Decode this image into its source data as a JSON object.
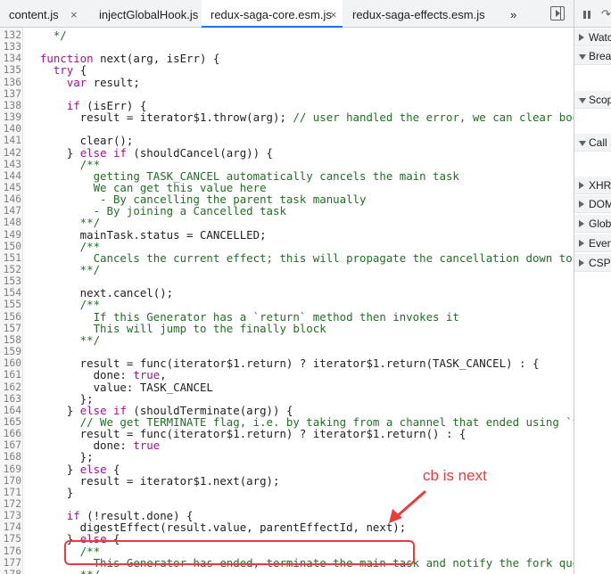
{
  "tabs": [
    {
      "label": "content.js",
      "closable": true,
      "active": false
    },
    {
      "label": "injectGlobalHook.js",
      "closable": false,
      "active": false
    },
    {
      "label": "redux-saga-core.esm.js",
      "closable": true,
      "active": true
    },
    {
      "label": "redux-saga-effects.esm.js",
      "closable": false,
      "active": false
    },
    {
      "label": "»",
      "closable": false,
      "active": false
    }
  ],
  "close_glyph": "×",
  "sidebar": {
    "step_glyph": "↷",
    "sections": [
      {
        "label": "Watch",
        "state": "closed"
      },
      {
        "label": "Breakpoints",
        "state": "open"
      },
      {
        "label": "Scope",
        "state": "open"
      },
      {
        "label": "Call Stack",
        "state": "open"
      },
      {
        "label": "XHR/fetch Breakpoints",
        "state": "closed"
      },
      {
        "label": "DOM Breakpoints",
        "state": "closed"
      },
      {
        "label": "Global Listeners",
        "state": "closed"
      },
      {
        "label": "Event Listener Breakpoints",
        "state": "closed"
      },
      {
        "label": "CSP Violation Breakpoints",
        "state": "closed"
      }
    ]
  },
  "annotation": {
    "text": "cb is next",
    "color": "#ee3a3a"
  },
  "code_lines": [
    {
      "n": "132",
      "t": [
        [
          "cm",
          "    */"
        ]
      ]
    },
    {
      "n": "133",
      "t": [
        [
          "pl",
          ""
        ]
      ]
    },
    {
      "n": "134",
      "t": [
        [
          "pl",
          "  "
        ],
        [
          "kw",
          "function"
        ],
        [
          "pl",
          " next(arg, isErr) {"
        ]
      ]
    },
    {
      "n": "135",
      "t": [
        [
          "pl",
          "    "
        ],
        [
          "kw",
          "try"
        ],
        [
          "pl",
          " {"
        ]
      ]
    },
    {
      "n": "136",
      "t": [
        [
          "pl",
          "      "
        ],
        [
          "kw",
          "var"
        ],
        [
          "pl",
          " result;"
        ]
      ]
    },
    {
      "n": "137",
      "t": [
        [
          "pl",
          ""
        ]
      ]
    },
    {
      "n": "138",
      "t": [
        [
          "pl",
          "      "
        ],
        [
          "kw",
          "if"
        ],
        [
          "pl",
          " (isErr) {"
        ]
      ]
    },
    {
      "n": "139",
      "t": [
        [
          "pl",
          "        result = iterator$1.throw(arg); "
        ],
        [
          "cm",
          "// user handled the error, we can clear bookke"
        ]
      ]
    },
    {
      "n": "140",
      "t": [
        [
          "pl",
          ""
        ]
      ]
    },
    {
      "n": "141",
      "t": [
        [
          "pl",
          "        clear();"
        ]
      ]
    },
    {
      "n": "142",
      "t": [
        [
          "pl",
          "      } "
        ],
        [
          "kw",
          "else if"
        ],
        [
          "pl",
          " (shouldCancel(arg)) {"
        ]
      ]
    },
    {
      "n": "143",
      "t": [
        [
          "cm",
          "        /**"
        ]
      ]
    },
    {
      "n": "144",
      "t": [
        [
          "cm",
          "          getting TASK_CANCEL automatically cancels the main task"
        ]
      ]
    },
    {
      "n": "145",
      "t": [
        [
          "cm",
          "          We can get this value here"
        ]
      ]
    },
    {
      "n": "146",
      "t": [
        [
          "cm",
          "           - By cancelling the parent task manually"
        ]
      ]
    },
    {
      "n": "147",
      "t": [
        [
          "cm",
          "          - By joining a Cancelled task"
        ]
      ]
    },
    {
      "n": "148",
      "t": [
        [
          "cm",
          "        **/"
        ]
      ]
    },
    {
      "n": "149",
      "t": [
        [
          "pl",
          "        mainTask.status = CANCELLED;"
        ]
      ]
    },
    {
      "n": "150",
      "t": [
        [
          "cm",
          "        /**"
        ]
      ]
    },
    {
      "n": "151",
      "t": [
        [
          "cm",
          "          Cancels the current effect; this will propagate the cancellation down to an"
        ]
      ]
    },
    {
      "n": "152",
      "t": [
        [
          "cm",
          "        **/"
        ]
      ]
    },
    {
      "n": "153",
      "t": [
        [
          "pl",
          ""
        ]
      ]
    },
    {
      "n": "154",
      "t": [
        [
          "pl",
          "        next.cancel();"
        ]
      ]
    },
    {
      "n": "155",
      "t": [
        [
          "cm",
          "        /**"
        ]
      ]
    },
    {
      "n": "156",
      "t": [
        [
          "cm",
          "          If this Generator has a `return` method then invokes it"
        ]
      ]
    },
    {
      "n": "157",
      "t": [
        [
          "cm",
          "          This will jump to the finally block"
        ]
      ]
    },
    {
      "n": "158",
      "t": [
        [
          "cm",
          "        **/"
        ]
      ]
    },
    {
      "n": "159",
      "t": [
        [
          "pl",
          ""
        ]
      ]
    },
    {
      "n": "160",
      "t": [
        [
          "pl",
          "        result = func(iterator$1.return) ? iterator$1.return(TASK_CANCEL) : {"
        ]
      ]
    },
    {
      "n": "161",
      "t": [
        [
          "pl",
          "          done: "
        ],
        [
          "kw",
          "true"
        ],
        [
          "pl",
          ","
        ]
      ]
    },
    {
      "n": "162",
      "t": [
        [
          "pl",
          "          value: TASK_CANCEL"
        ]
      ]
    },
    {
      "n": "163",
      "t": [
        [
          "pl",
          "        };"
        ]
      ]
    },
    {
      "n": "164",
      "t": [
        [
          "pl",
          "      } "
        ],
        [
          "kw",
          "else if"
        ],
        [
          "pl",
          " (shouldTerminate(arg)) {"
        ]
      ]
    },
    {
      "n": "165",
      "t": [
        [
          "cm",
          "        // We get TERMINATE flag, i.e. by taking from a channel that ended using `tak"
        ]
      ]
    },
    {
      "n": "166",
      "t": [
        [
          "pl",
          "        result = func(iterator$1.return) ? iterator$1.return() : {"
        ]
      ]
    },
    {
      "n": "167",
      "t": [
        [
          "pl",
          "          done: "
        ],
        [
          "kw",
          "true"
        ]
      ]
    },
    {
      "n": "168",
      "t": [
        [
          "pl",
          "        };"
        ]
      ]
    },
    {
      "n": "169",
      "t": [
        [
          "pl",
          "      } "
        ],
        [
          "kw",
          "else"
        ],
        [
          "pl",
          " {"
        ]
      ]
    },
    {
      "n": "170",
      "t": [
        [
          "pl",
          "        result = iterator$1.next(arg);"
        ]
      ]
    },
    {
      "n": "171",
      "t": [
        [
          "pl",
          "      }"
        ]
      ]
    },
    {
      "n": "172",
      "t": [
        [
          "pl",
          ""
        ]
      ]
    },
    {
      "n": "173",
      "t": [
        [
          "pl",
          "      "
        ],
        [
          "kw",
          "if"
        ],
        [
          "pl",
          " (!result.done) {"
        ]
      ]
    },
    {
      "n": "174",
      "t": [
        [
          "pl",
          "        digestEffect(result.value, parentEffectId, next);"
        ]
      ]
    },
    {
      "n": "175",
      "t": [
        [
          "pl",
          "      } "
        ],
        [
          "kw",
          "else"
        ],
        [
          "pl",
          " {"
        ]
      ]
    },
    {
      "n": "176",
      "t": [
        [
          "cm",
          "        /**"
        ]
      ]
    },
    {
      "n": "177",
      "t": [
        [
          "cm",
          "          This Generator has ended, terminate the main task and notify the fork queue"
        ]
      ]
    },
    {
      "n": "178",
      "t": [
        [
          "cm",
          "        **/"
        ]
      ]
    }
  ]
}
